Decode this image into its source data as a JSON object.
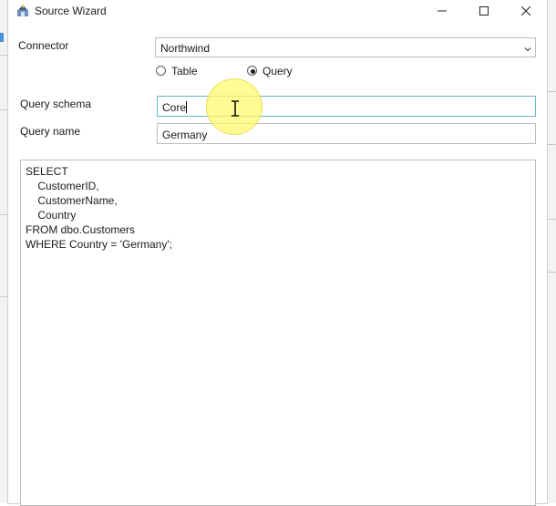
{
  "window": {
    "title": "Source Wizard",
    "icons": {
      "app": "wizard-app-icon",
      "minimize": "minimize-icon",
      "maximize": "maximize-icon",
      "close": "close-icon"
    }
  },
  "form": {
    "connector_label": "Connector",
    "connector_value": "Northwind",
    "mode_options": [
      {
        "label": "Table",
        "selected": false
      },
      {
        "label": "Query",
        "selected": true
      }
    ],
    "schema_label": "Query schema",
    "schema_value": "Core",
    "name_label": "Query name",
    "name_value": "Germany"
  },
  "editor": {
    "sql": "SELECT\n    CustomerID,\n    CustomerName,\n    Country\nFROM dbo.Customers\nWHERE Country = 'Germany';"
  },
  "colors": {
    "focus_border": "#6bb3c7",
    "cursor_highlight": "#fff96e"
  }
}
